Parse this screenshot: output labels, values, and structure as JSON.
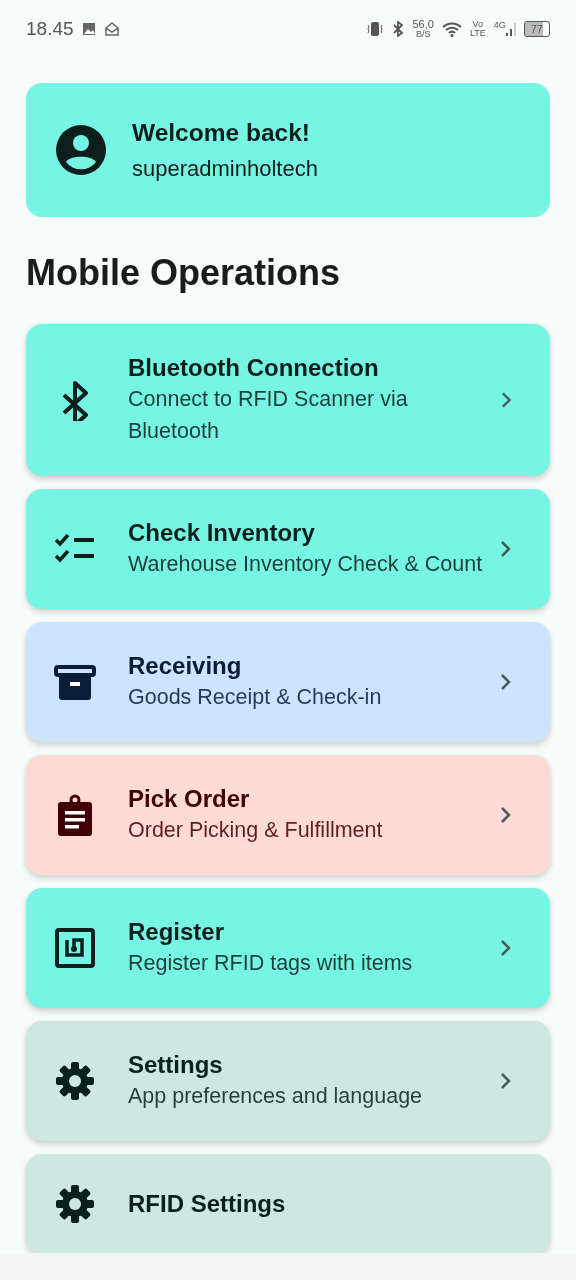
{
  "status_bar": {
    "time": "18.45",
    "speed": "56,0",
    "speed_unit": "B/S",
    "volte_top": "Vo",
    "volte_bottom": "LTE",
    "network": "4G",
    "battery": "77"
  },
  "welcome": {
    "title": "Welcome back!",
    "username": "superadminholtech"
  },
  "section_title": "Mobile Operations",
  "operations": [
    {
      "kind": "bluetooth",
      "title": "Bluetooth Connection",
      "subtitle": "Connect to RFID Scanner via Bluetooth",
      "color": "#76f5e4"
    },
    {
      "kind": "checklist",
      "title": "Check Inventory",
      "subtitle": "Warehouse Inventory Check & Count",
      "color": "#76f5e4"
    },
    {
      "kind": "archive",
      "title": "Receiving",
      "subtitle": "Goods Receipt & Check-in",
      "color": "#cce4fd"
    },
    {
      "kind": "clipboard",
      "title": "Pick Order",
      "subtitle": "Order Picking & Fulfillment",
      "color": "#ffdad6"
    },
    {
      "kind": "nfc",
      "title": "Register",
      "subtitle": "Register RFID tags with items",
      "color": "#76f5e4"
    },
    {
      "kind": "gear",
      "title": "Settings",
      "subtitle": "App preferences and language",
      "color": "#cde7e1"
    },
    {
      "kind": "gear",
      "title": "RFID Settings",
      "color": "#cde7e1"
    }
  ]
}
